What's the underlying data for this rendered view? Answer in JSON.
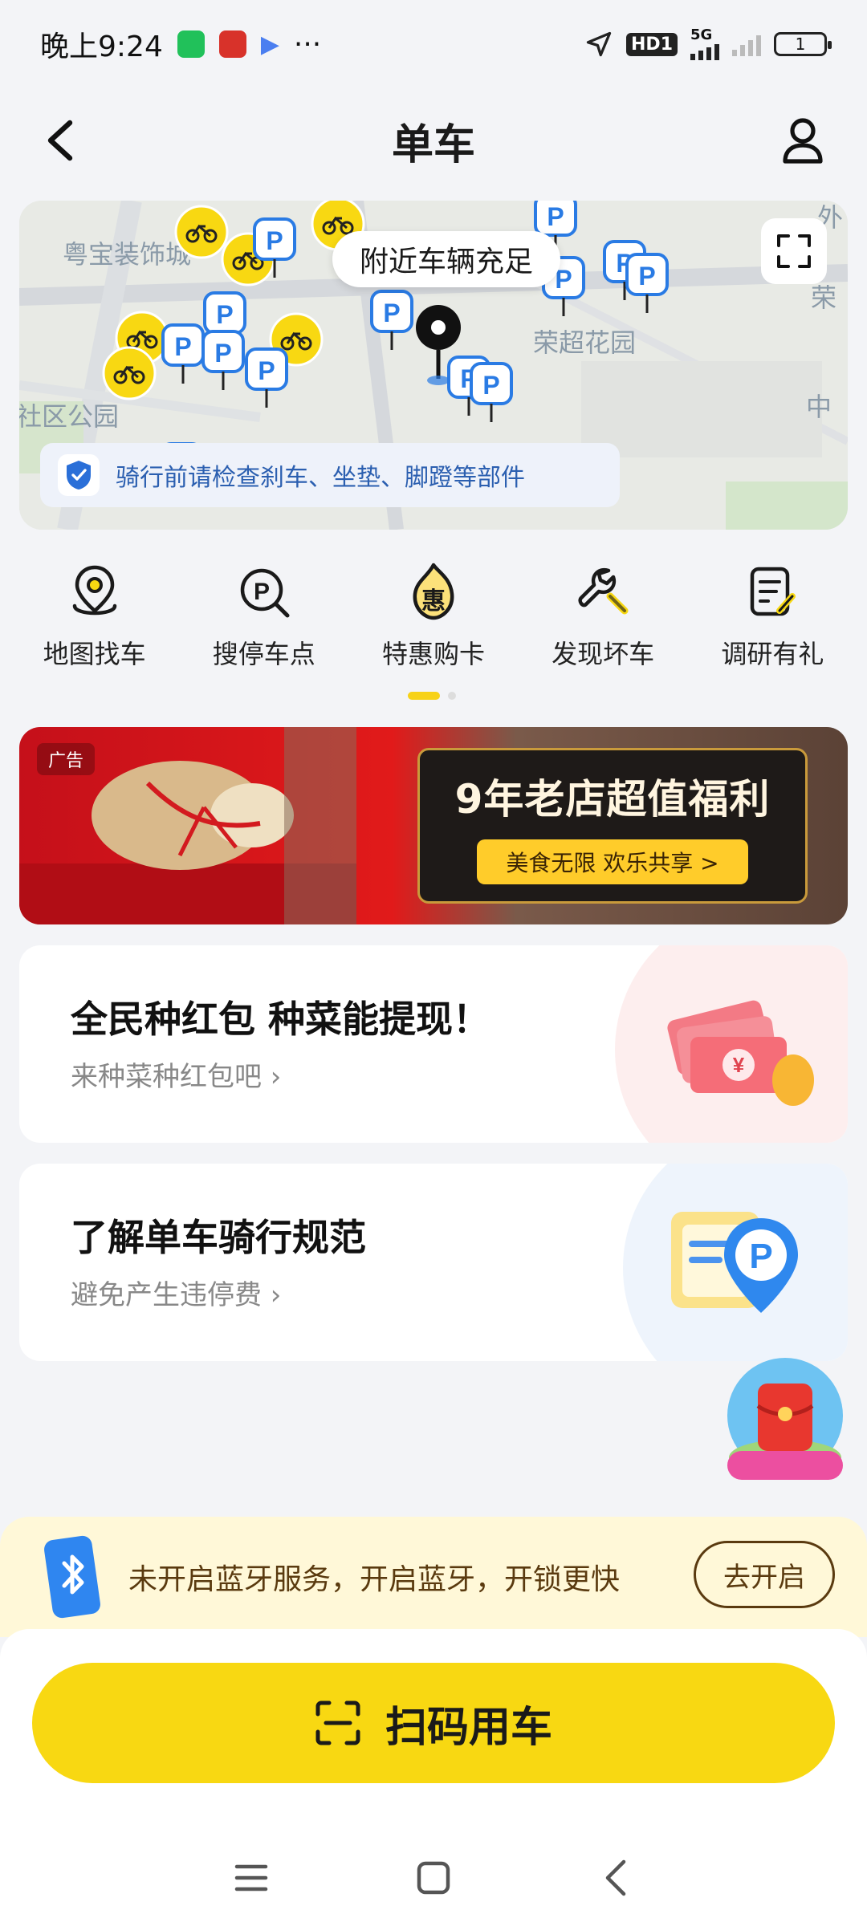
{
  "status_bar": {
    "time": "晚上9:24",
    "more": "···",
    "network_badge": "HD1",
    "network_type": "5G",
    "battery": "1"
  },
  "header": {
    "title": "单车"
  },
  "map": {
    "bubble_text": "附近车辆充足",
    "labels": {
      "label_1": "粤宝装饰城",
      "label_2": "荣超花园",
      "label_3": "社区公园",
      "label_4": "中",
      "label_5": "荣",
      "label_6": "外"
    },
    "notice": "骑行前请检查刹车、坐垫、脚蹬等部件"
  },
  "quick_menu": [
    {
      "label": "地图找车",
      "icon": "map-pin-icon"
    },
    {
      "label": "搜停车点",
      "icon": "parking-search-icon"
    },
    {
      "label": "特惠购卡",
      "icon": "discount-card-icon",
      "icon_text": "惠"
    },
    {
      "label": "发现坏车",
      "icon": "wrench-icon"
    },
    {
      "label": "调研有礼",
      "icon": "survey-icon"
    }
  ],
  "ad": {
    "tag": "广告",
    "title": "9年老店超值福利",
    "subtitle": "美食无限 欢乐共享 >"
  },
  "cards": [
    {
      "title": "全民种红包 种菜能提现！",
      "subtitle": "来种菜种红包吧 ›"
    },
    {
      "title": "了解单车骑行规范",
      "subtitle": "避免产生违停费 ›"
    }
  ],
  "bluetooth": {
    "text": "未开启蓝牙服务，开启蓝牙，开锁更快",
    "button": "去开启"
  },
  "scan": {
    "label": "扫码用车"
  },
  "colors": {
    "accent_yellow": "#f8d812",
    "notice_blue": "#2b5fb0",
    "bt_brown": "#5a3a0f"
  }
}
